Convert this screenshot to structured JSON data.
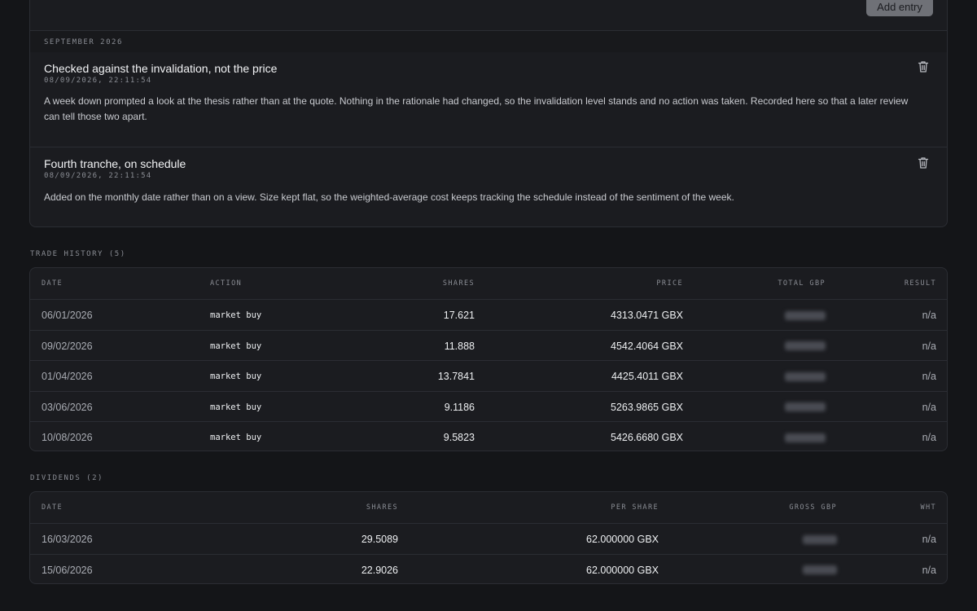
{
  "journal": {
    "add_button": "Add entry",
    "month_label": "SEPTEMBER 2026",
    "entries": [
      {
        "title": "Checked against the invalidation, not the price",
        "timestamp": "08/09/2026, 22:11:54",
        "body": "A week down prompted a look at the thesis rather than at the quote. Nothing in the rationale had changed, so the invalidation level stands and no action was taken. Recorded here so that a later review can tell those two apart."
      },
      {
        "title": "Fourth tranche, on schedule",
        "timestamp": "08/09/2026, 22:11:54",
        "body": "Added on the monthly date rather than on a view. Size kept flat, so the weighted-average cost keeps tracking the schedule instead of the sentiment of the week."
      }
    ]
  },
  "trades": {
    "title": "TRADE HISTORY (5)",
    "columns": [
      "DATE",
      "ACTION",
      "SHARES",
      "PRICE",
      "TOTAL GBP",
      "RESULT"
    ],
    "rows": [
      {
        "date": "06/01/2026",
        "action": "market buy",
        "shares": "17.621",
        "price": "4313.0471 GBX",
        "result": "n/a"
      },
      {
        "date": "09/02/2026",
        "action": "market buy",
        "shares": "11.888",
        "price": "4542.4064 GBX",
        "result": "n/a"
      },
      {
        "date": "01/04/2026",
        "action": "market buy",
        "shares": "13.7841",
        "price": "4425.4011 GBX",
        "result": "n/a"
      },
      {
        "date": "03/06/2026",
        "action": "market buy",
        "shares": "9.1186",
        "price": "5263.9865 GBX",
        "result": "n/a"
      },
      {
        "date": "10/08/2026",
        "action": "market buy",
        "shares": "9.5823",
        "price": "5426.6680 GBX",
        "result": "n/a"
      }
    ]
  },
  "dividends": {
    "title": "DIVIDENDS (2)",
    "columns": [
      "DATE",
      "SHARES",
      "PER SHARE",
      "GROSS GBP",
      "WHT"
    ],
    "rows": [
      {
        "date": "16/03/2026",
        "shares": "29.5089",
        "per_share": "62.000000 GBX",
        "wht": "n/a"
      },
      {
        "date": "15/06/2026",
        "shares": "22.9026",
        "per_share": "62.000000 GBX",
        "wht": "n/a"
      }
    ]
  },
  "icons": {
    "delete": "trash-icon"
  }
}
